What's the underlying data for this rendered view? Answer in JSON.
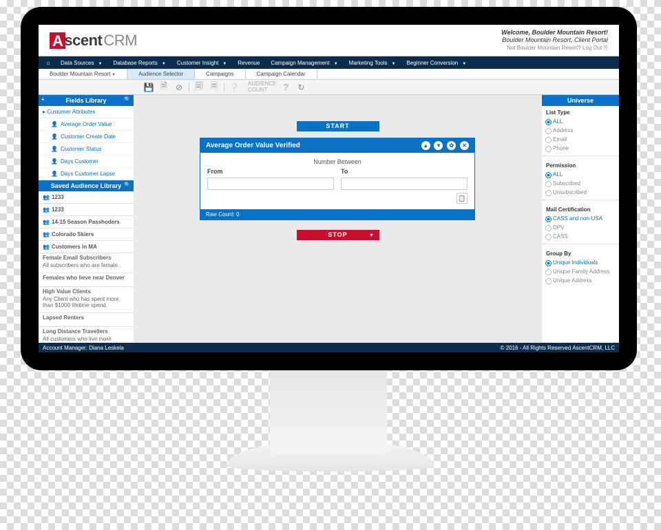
{
  "brand": {
    "a": "A",
    "rest": "scent",
    "suffix": "CRM"
  },
  "welcome": {
    "line1": "Welcome, Boulder Mountain Resort!",
    "line2": "Boulder Mountain Resort, Client Portal",
    "line3": "Not Boulder Mountain Resort? Log Out ⎘"
  },
  "nav": {
    "items": [
      "Data Sources",
      "Database Reports",
      "Customer Insight",
      "Revenue",
      "Campaign Management",
      "Marketing Tools",
      "Beginner Conversion"
    ]
  },
  "subnav": {
    "resort": "Boulder Mountain Resort",
    "tabs": [
      "Audience Selector",
      "Campaigns",
      "Campaign Calendar"
    ]
  },
  "toolbar": {
    "count_label": "AUDIENCE",
    "count_label2": "COUNT"
  },
  "fields": {
    "title": "Fields Library",
    "category": "Customer Attributes",
    "attrs": [
      "Average Order Value",
      "Customer Create Date",
      "Customer Status",
      "Days Customer",
      "Days Customer Lapse"
    ]
  },
  "saved": {
    "title": "Saved Audience Library",
    "short": [
      "1233",
      "1233",
      "14-15 Season Passhoders",
      "Colorado Skiers",
      "Customers in MA"
    ],
    "desc": [
      {
        "t": "Female Email Subscribers",
        "d": "All subscribers who are female."
      },
      {
        "t": "Females who lieve near Denver",
        "d": ""
      },
      {
        "t": "High Value Clients",
        "d": "Any Client who has spent more than $1000 lifetime spend."
      },
      {
        "t": "Lapsed Renters",
        "d": ""
      },
      {
        "t": "Long Distance Travellers",
        "d": "All customers who live more"
      }
    ]
  },
  "canvas": {
    "start": "START",
    "stop": "STOP",
    "filter": {
      "title": "Average Order Value Verified",
      "subtitle": "Number Between",
      "from": "From",
      "to": "To",
      "raw": "Raw Count: 0"
    }
  },
  "universe": {
    "title": "Universe",
    "listtype": {
      "title": "List Type",
      "opts": [
        "ALL",
        "Address",
        "Email",
        "Phone"
      ],
      "sel": 0
    },
    "permission": {
      "title": "Permission",
      "opts": [
        "ALL",
        "Subscribed",
        "Unsubscribed"
      ],
      "sel": 0
    },
    "mailcert": {
      "title": "Mail Certification",
      "opts": [
        "CASS and non-USA",
        "DPV",
        "CASS"
      ],
      "sel": 0
    },
    "groupby": {
      "title": "Group By",
      "opts": [
        "Unique Individuals",
        "Unique Family Address",
        "Unique Address"
      ],
      "sel": 0
    }
  },
  "footer": {
    "left": "Account Manager: Diana Leskela",
    "right": "© 2016 - All Rights Reserved AscentCRM, LLC"
  }
}
